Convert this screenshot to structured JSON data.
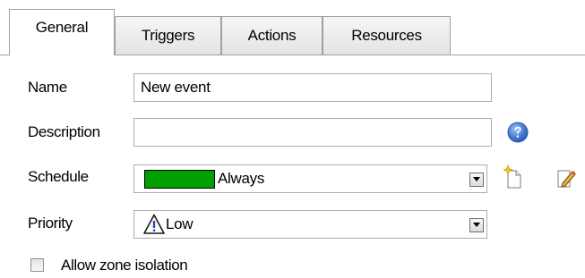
{
  "tabs": [
    {
      "label": "General",
      "active": true
    },
    {
      "label": "Triggers",
      "active": false
    },
    {
      "label": "Actions",
      "active": false
    },
    {
      "label": "Resources",
      "active": false
    }
  ],
  "form": {
    "name": {
      "label": "Name",
      "value": "New event"
    },
    "description": {
      "label": "Description",
      "value": ""
    },
    "schedule": {
      "label": "Schedule",
      "value": "Always",
      "color": "#00a000"
    },
    "priority": {
      "label": "Priority",
      "value": "Low"
    },
    "allow_zone_isolation": {
      "label": "Allow zone isolation",
      "checked": false
    }
  },
  "icons": {
    "help": "help-icon",
    "new_schedule": "new-document-icon",
    "edit_schedule": "edit-pencil-icon",
    "priority": "warning-triangle-icon",
    "dropdown": "chevron-down-icon"
  },
  "colors": {
    "help_icon": "#4a7fd6",
    "schedule_swatch": "#00a000"
  }
}
